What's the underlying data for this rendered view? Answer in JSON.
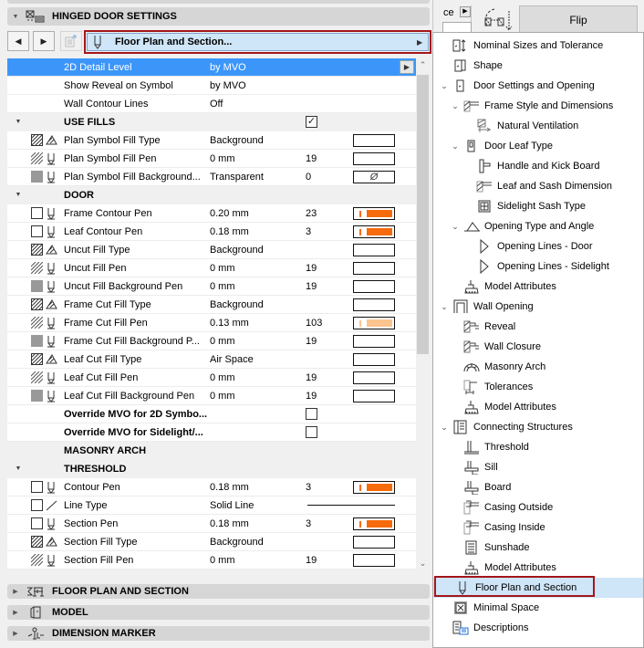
{
  "panel": {
    "section_title": "HINGED DOOR SETTINGS",
    "nav": {
      "prev": "◀",
      "next": "▶"
    },
    "page_selector": {
      "label": "Floor Plan and Section...",
      "icon": "pen-icon"
    }
  },
  "grid": {
    "rows": [
      {
        "type": "param",
        "selected": true,
        "name": "2D Detail Level",
        "value": "by MVO",
        "dropdown": true
      },
      {
        "type": "param",
        "name": "Show Reveal on Symbol",
        "value": "by MVO"
      },
      {
        "type": "param",
        "name": "Wall Contour Lines",
        "value": "Off"
      },
      {
        "type": "group",
        "expanded": true,
        "name": "USE FILLS",
        "checkbox": true,
        "checked": true
      },
      {
        "type": "param",
        "icon1": "fill-hatch",
        "icon2": "fill-type",
        "name": "Plan Symbol Fill Type",
        "value": "Background",
        "swatch": "empty"
      },
      {
        "type": "param",
        "icon1": "fill-pen-hatch",
        "icon2": "pen",
        "name": "Plan Symbol Fill Pen",
        "value": "0 mm",
        "num": "19",
        "swatch": "empty"
      },
      {
        "type": "param",
        "icon1": "fill-bg",
        "icon2": "pen",
        "name": "Plan Symbol Fill Background...",
        "value": "Transparent",
        "num": "0",
        "swatch": "none",
        "swatch_text": "Ø"
      },
      {
        "type": "group",
        "expanded": true,
        "name": "DOOR"
      },
      {
        "type": "param",
        "icon1": "checkbox-empty",
        "icon2": "pen",
        "name": "Frame Contour Pen",
        "value": "0.20 mm",
        "num": "23",
        "swatch": "pen",
        "color": "#f76b0c"
      },
      {
        "type": "param",
        "icon1": "checkbox-empty",
        "icon2": "pen",
        "name": "Leaf Contour Pen",
        "value": "0.18 mm",
        "num": "3",
        "swatch": "pen",
        "color": "#f76b0c"
      },
      {
        "type": "param",
        "icon1": "fill-hatch",
        "icon2": "fill-type",
        "name": "Uncut Fill Type",
        "value": "Background",
        "swatch": "empty"
      },
      {
        "type": "param",
        "icon1": "fill-pen-hatch",
        "icon2": "pen",
        "name": "Uncut Fill Pen",
        "value": "0 mm",
        "num": "19",
        "swatch": "empty"
      },
      {
        "type": "param",
        "icon1": "fill-bg",
        "icon2": "pen",
        "name": "Uncut Fill Background Pen",
        "value": "0 mm",
        "num": "19",
        "swatch": "empty"
      },
      {
        "type": "param",
        "icon1": "fill-hatch",
        "icon2": "fill-type",
        "name": "Frame Cut Fill Type",
        "value": "Background",
        "swatch": "empty"
      },
      {
        "type": "param",
        "icon1": "fill-pen-hatch",
        "icon2": "pen",
        "name": "Frame Cut Fill Pen",
        "value": "0.13 mm",
        "num": "103",
        "swatch": "pen",
        "color": "#fcc48e"
      },
      {
        "type": "param",
        "icon1": "fill-bg",
        "icon2": "pen",
        "name": "Frame Cut Fill Background P...",
        "value": "0 mm",
        "num": "19",
        "swatch": "empty"
      },
      {
        "type": "param",
        "icon1": "fill-hatch",
        "icon2": "fill-type",
        "name": "Leaf Cut Fill Type",
        "value": "Air Space",
        "swatch": "empty"
      },
      {
        "type": "param",
        "icon1": "fill-pen-hatch",
        "icon2": "pen",
        "name": "Leaf Cut Fill Pen",
        "value": "0 mm",
        "num": "19",
        "swatch": "empty"
      },
      {
        "type": "param",
        "icon1": "fill-bg",
        "icon2": "pen",
        "name": "Leaf Cut Fill Background Pen",
        "value": "0 mm",
        "num": "19",
        "swatch": "empty"
      },
      {
        "type": "param",
        "bold": true,
        "name": "Override MVO for 2D Symbo...",
        "checkbox": true,
        "checked": false
      },
      {
        "type": "param",
        "bold": true,
        "name": "Override MVO for Sidelight/...",
        "checkbox": true,
        "checked": false
      },
      {
        "type": "group",
        "expanded": false,
        "name": "MASONRY ARCH"
      },
      {
        "type": "group",
        "expanded": true,
        "name": "THRESHOLD"
      },
      {
        "type": "param",
        "icon1": "checkbox-empty",
        "icon2": "pen",
        "name": "Contour Pen",
        "value": "0.18 mm",
        "num": "3",
        "swatch": "pen",
        "color": "#f76b0c"
      },
      {
        "type": "param",
        "icon1": "checkbox-empty",
        "icon2": "line",
        "name": "Line Type",
        "value": "Solid Line",
        "swatch": "line"
      },
      {
        "type": "param",
        "icon1": "checkbox-empty",
        "icon2": "pen",
        "name": "Section Pen",
        "value": "0.18 mm",
        "num": "3",
        "swatch": "pen",
        "color": "#f76b0c"
      },
      {
        "type": "param",
        "icon1": "fill-hatch",
        "icon2": "fill-type",
        "name": "Section Fill Type",
        "value": "Background",
        "swatch": "empty"
      },
      {
        "type": "param",
        "icon1": "fill-pen-hatch",
        "icon2": "pen",
        "name": "Section Fill Pen",
        "value": "0 mm",
        "num": "19",
        "swatch": "empty"
      }
    ]
  },
  "bottom_sections": [
    {
      "label": "FLOOR PLAN AND SECTION",
      "icon": "floor-plan-icon"
    },
    {
      "label": "MODEL",
      "icon": "model-icon"
    },
    {
      "label": "DIMENSION MARKER",
      "icon": "dimension-marker-icon"
    }
  ],
  "topbar": {
    "partial_label": "ce",
    "flip_label": "Flip"
  },
  "tree": {
    "items": [
      {
        "label": "Nominal Sizes and Tolerance",
        "level": 1,
        "chev": "",
        "icon": "nominal-sizes-icon"
      },
      {
        "label": "Shape",
        "level": 1,
        "chev": "",
        "icon": "shape-icon"
      },
      {
        "label": "Door Settings and Opening",
        "level": 1,
        "chev": "v",
        "icon": "door-icon"
      },
      {
        "label": "Frame Style and Dimensions",
        "level": 2,
        "chev": "v",
        "icon": "frame-icon"
      },
      {
        "label": "Natural Ventilation",
        "level": 3,
        "chev": "",
        "icon": "ventilation-icon"
      },
      {
        "label": "Door Leaf Type",
        "level": 2,
        "chev": "v",
        "icon": "door-leaf-icon"
      },
      {
        "label": "Handle and Kick Board",
        "level": 3,
        "chev": "",
        "icon": "handle-icon"
      },
      {
        "label": "Leaf and Sash Dimension",
        "level": 3,
        "chev": "",
        "icon": "frame-icon"
      },
      {
        "label": "Sidelight Sash Type",
        "level": 3,
        "chev": "",
        "icon": "sash-icon"
      },
      {
        "label": "Opening Type and Angle",
        "level": 2,
        "chev": "v",
        "icon": "opening-angle-icon"
      },
      {
        "label": "Opening Lines - Door",
        "level": 3,
        "chev": "",
        "icon": "opening-lines-icon"
      },
      {
        "label": "Opening Lines - Sidelight",
        "level": 3,
        "chev": "",
        "icon": "opening-lines-icon"
      },
      {
        "label": "Model Attributes",
        "level": 2,
        "chev": "",
        "icon": "brush-icon"
      },
      {
        "label": "Wall Opening",
        "level": 1,
        "chev": "v",
        "icon": "wall-opening-icon"
      },
      {
        "label": "Reveal",
        "level": 2,
        "chev": "",
        "icon": "reveal-icon"
      },
      {
        "label": "Wall Closure",
        "level": 2,
        "chev": "",
        "icon": "reveal-icon"
      },
      {
        "label": "Masonry Arch",
        "level": 2,
        "chev": "",
        "icon": "arch-icon"
      },
      {
        "label": "Tolerances",
        "level": 2,
        "chev": "",
        "icon": "tolerance-icon"
      },
      {
        "label": "Model Attributes",
        "level": 2,
        "chev": "",
        "icon": "brush-icon"
      },
      {
        "label": "Connecting Structures",
        "level": 1,
        "chev": "v",
        "icon": "connecting-icon"
      },
      {
        "label": "Threshold",
        "level": 2,
        "chev": "",
        "icon": "threshold-icon"
      },
      {
        "label": "Sill",
        "level": 2,
        "chev": "",
        "icon": "sill-icon"
      },
      {
        "label": "Board",
        "level": 2,
        "chev": "",
        "icon": "sill-icon"
      },
      {
        "label": "Casing Outside",
        "level": 2,
        "chev": "",
        "icon": "casing-icon"
      },
      {
        "label": "Casing Inside",
        "level": 2,
        "chev": "",
        "icon": "casing-icon"
      },
      {
        "label": "Sunshade",
        "level": 2,
        "chev": "",
        "icon": "sunshade-icon"
      },
      {
        "label": "Model Attributes",
        "level": 2,
        "chev": "",
        "icon": "brush-icon"
      },
      {
        "label": "Floor Plan and Section",
        "level": 1,
        "chev": "",
        "icon": "pen-icon",
        "selected": true
      },
      {
        "label": "Minimal Space",
        "level": 1,
        "chev": "",
        "icon": "minimal-space-icon"
      },
      {
        "label": "Descriptions",
        "level": 1,
        "chev": "",
        "icon": "descriptions-icon"
      }
    ]
  }
}
